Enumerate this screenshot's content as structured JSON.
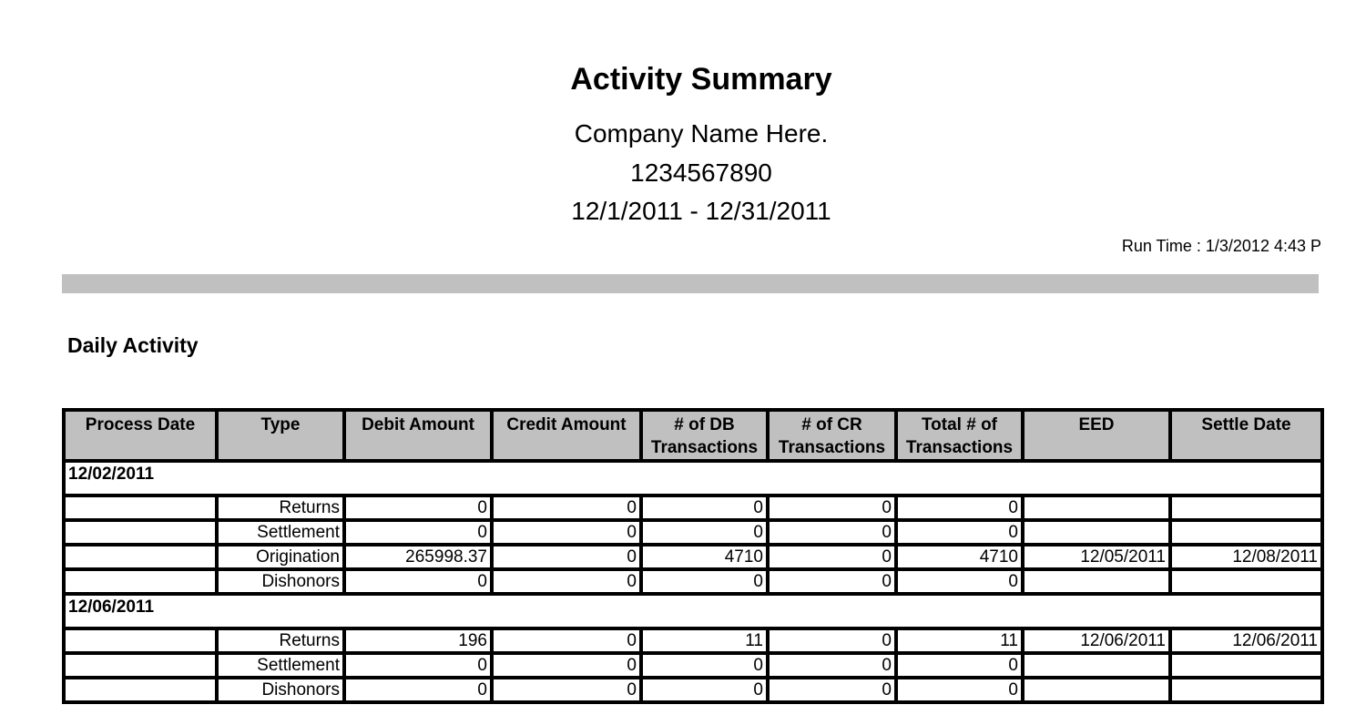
{
  "report": {
    "title": "Activity Summary",
    "company": "Company Name Here.",
    "account": "1234567890",
    "date_range": "12/1/2011 - 12/31/2011",
    "run_time": "Run Time : 1/3/2012 4:43 P"
  },
  "section_title": "Daily Activity",
  "table": {
    "headers": [
      "Process Date",
      "Type",
      "Debit Amount",
      "Credit Amount",
      "# of DB Transactions",
      "# of CR Transactions",
      "Total # of Transactions",
      "EED",
      "Settle Date"
    ],
    "groups": [
      {
        "date": "12/02/2011",
        "rows": [
          [
            "",
            "Returns",
            "0",
            "0",
            "0",
            "0",
            "0",
            "",
            ""
          ],
          [
            "",
            "Settlement",
            "0",
            "0",
            "0",
            "0",
            "0",
            "",
            ""
          ],
          [
            "",
            "Origination",
            "265998.37",
            "0",
            "4710",
            "0",
            "4710",
            "12/05/2011",
            "12/08/2011"
          ],
          [
            "",
            "Dishonors",
            "0",
            "0",
            "0",
            "0",
            "0",
            "",
            ""
          ]
        ]
      },
      {
        "date": "12/06/2011",
        "rows": [
          [
            "",
            "Returns",
            "196",
            "0",
            "11",
            "0",
            "11",
            "12/06/2011",
            "12/06/2011"
          ],
          [
            "",
            "Settlement",
            "0",
            "0",
            "0",
            "0",
            "0",
            "",
            ""
          ],
          [
            "",
            "Dishonors",
            "0",
            "0",
            "0",
            "0",
            "0",
            "",
            ""
          ]
        ]
      }
    ]
  }
}
